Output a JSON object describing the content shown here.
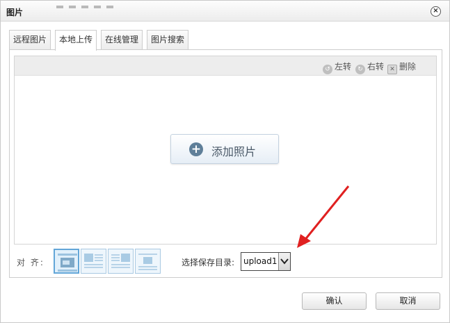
{
  "dialog": {
    "title": "图片",
    "close_glyph": "×"
  },
  "tabs": [
    {
      "label": "远程图片",
      "active": false
    },
    {
      "label": "本地上传",
      "active": true
    },
    {
      "label": "在线管理",
      "active": false
    },
    {
      "label": "图片搜索",
      "active": false
    }
  ],
  "toolbar": {
    "rotate_left": "左转",
    "rotate_right": "右转",
    "delete": "删除"
  },
  "upload": {
    "add_photo_label": "添加照片"
  },
  "alignment": {
    "label": "对 齐:",
    "options": [
      "align-none",
      "align-left",
      "align-right",
      "align-center"
    ],
    "selected": "align-none"
  },
  "save_dir": {
    "label": "选择保存目录:",
    "value": "upload1"
  },
  "footer": {
    "confirm": "确认",
    "cancel": "取消"
  },
  "annotation": {
    "arrow_color": "#e02020"
  },
  "colors": {
    "accent": "#62a6d8",
    "toolbar_bg": "#ededed"
  }
}
